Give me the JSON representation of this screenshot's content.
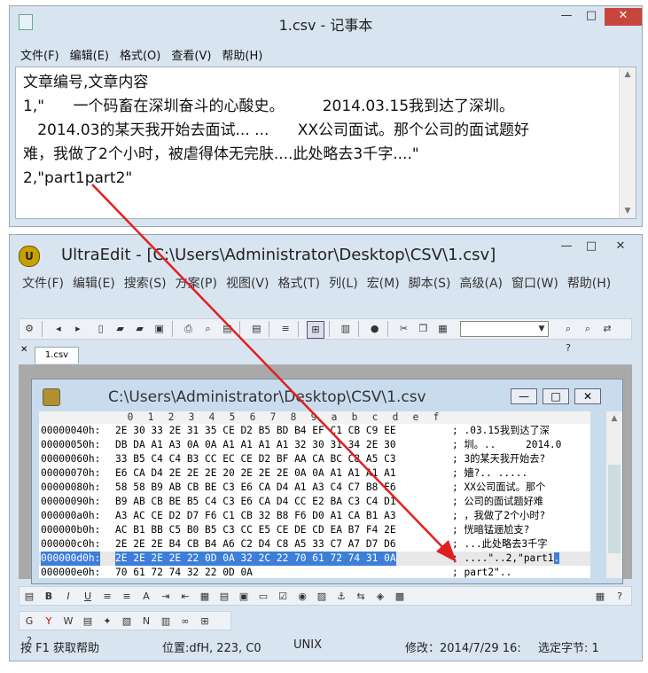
{
  "notepad": {
    "title": "1.csv - 记事本",
    "menu": [
      "文件(F)",
      "编辑(E)",
      "格式(O)",
      "查看(V)",
      "帮助(H)"
    ],
    "content": "文章编号,文章内容\n1,\"      一个码畜在深圳奋斗的心酸史。        2014.03.15我到达了深圳。\n   2014.03的某天我开始去面试... ...      XX公司面试。那个公司的面试题好\n难，我做了2个小时，被虐得体无完肤....此处略去3千字....\"\n2,\"part1part2\"",
    "close_glyph": "✕"
  },
  "ultraedit": {
    "title": "UltraEdit - [C:\\Users\\Administrator\\Desktop\\CSV\\1.csv]",
    "menu": [
      "文件(F)",
      "编辑(E)",
      "搜索(S)",
      "方案(P)",
      "视图(V)",
      "格式(T)",
      "列(L)",
      "宏(M)",
      "脚本(S)",
      "高级(A)",
      "窗口(W)",
      "帮助(H)"
    ],
    "tab_label": "1.csv",
    "child_title": "C:\\Users\\Administrator\\Desktop\\CSV\\1.csv",
    "hex_header": [
      "0",
      "1",
      "2",
      "3",
      "4",
      "5",
      "6",
      "7",
      "8",
      "9",
      "a",
      "b",
      "c",
      "d",
      "e",
      "f"
    ],
    "hex_rows": [
      {
        "off": "00000040h:",
        "hex": "2E 30 33 2E 31 35 CE D2 B5 BD B4 EF C1 CB C9 EE",
        "asc": "; .03.15我到达了深"
      },
      {
        "off": "00000050h:",
        "hex": "DB DA A1 A3 0A 0A A1 A1 A1 A1 32 30 31 34 2E 30",
        "asc": "; 圳。..     2014.0"
      },
      {
        "off": "00000060h:",
        "hex": "33 B5 C4 C4 B3 CC EC CE D2 BF AA CA BC C8 A5 C3",
        "asc": "; 3的某天我开始去?"
      },
      {
        "off": "00000070h:",
        "hex": "E6 CA D4 2E 2E 2E 20 2E 2E 2E 0A 0A A1 A1 A1 A1",
        "asc": "; 嬙?.. .....      "
      },
      {
        "off": "00000080h:",
        "hex": "58 58 B9 AB CB BE C3 E6 CA D4 A1 A3 C4 C7 B8 F6",
        "asc": "; XX公司面试。那个"
      },
      {
        "off": "00000090h:",
        "hex": "B9 AB CB BE B5 C4 C3 E6 CA D4 CC E2 BA C3 C4 D1",
        "asc": "; 公司的面试题好难"
      },
      {
        "off": "000000a0h:",
        "hex": "A3 AC CE D2 D7 F6 C1 CB 32 B8 F6 D0 A1 CA B1 A3",
        "asc": "; ，我做了2个小时?"
      },
      {
        "off": "000000b0h:",
        "hex": "AC B1 BB C5 B0 B5 C3 CC E5 CE DE CD EA B7 F4 2E",
        "asc": "; 恍暗锰逦尬支?"
      },
      {
        "off": "000000c0h:",
        "hex": "2E 2E 2E B4 CB B4 A6 C2 D4 C8 A5 33 C7 A7 D7 D6",
        "asc": "; ...此处略去3千字"
      },
      {
        "off": "000000d0h:",
        "hex": "2E 2E 2E 2E 22 0D 0A 32 2C 22 70 61 72 74 31 0A",
        "asc_pre": "; ....\"..2,\"part1",
        "asc_hl": ".",
        "selected": true
      },
      {
        "off": "000000e0h:",
        "hex": "70 61 72 74 32 22 0D 0A",
        "asc": "; part2\".."
      }
    ],
    "status": {
      "help": "按 F1 获取帮助",
      "position": "位置:dfH, 223, C0",
      "encoding": "UNIX",
      "modified": "修改：2014/7/29 16:",
      "selection": "选定字节: 1"
    },
    "colors": {
      "selection": "#3d7ed8",
      "arrow": "#e02020",
      "close_button": "#c7463b"
    }
  }
}
